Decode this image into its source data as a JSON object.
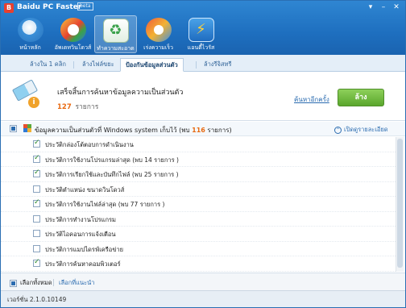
{
  "app": {
    "logo_char": "B",
    "title": "Baidu PC Faster",
    "badge": "beta"
  },
  "window_controls": {
    "feedback": "▾",
    "minimize": "–",
    "close": "✕"
  },
  "nav": [
    {
      "label": "หน้าหลัก",
      "icon": "home-gauge-icon"
    },
    {
      "label": "อัพเดทวินโดวส์",
      "icon": "windows-update-icon"
    },
    {
      "label": "ทำความสะอาด",
      "icon": "recycle-clean-icon"
    },
    {
      "label": "เร่งความเร็ว",
      "icon": "speed-icon"
    },
    {
      "label": "แอนตี้ไวรัส",
      "icon": "antivirus-lightning-icon"
    }
  ],
  "tabs": [
    {
      "label": "ล้างใน 1 คลิก"
    },
    {
      "label": "ล้างไฟล์ขยะ"
    },
    {
      "label": "ป้องกันข้อมูลส่วนตัว",
      "active": true
    },
    {
      "label": "ล้างรีจิสทรี"
    }
  ],
  "summary": {
    "title": "เสร็จสิ้นการค้นหาข้อมูลความเป็นส่วนตัว",
    "count": "127",
    "count_unit": "รายการ",
    "rescan": "ค้นหาอีกครั้ง",
    "clean_button": "ล้าง"
  },
  "group": {
    "title_prefix": "ข้อมูลความเป็นส่วนตัวที่ Windows system เก็บไว้ (พบ",
    "count": "116",
    "title_suffix": "รายการ)",
    "expand": "เปิดดูรายละเอียด"
  },
  "items": [
    {
      "label": "ประวัติกล่องโต้ตอบการดำเนินงาน",
      "checked": true
    },
    {
      "label": "ประวัติการใช้งานโปรแกรมล่าสุด (พบ 14 รายการ )",
      "checked": true
    },
    {
      "label": "ประวัติการเรียกใช้และบันทึกไฟล์ (พบ 25 รายการ )",
      "checked": true
    },
    {
      "label": "ประวัติตำแหน่ง ขนาดวินโดวส์",
      "checked": false
    },
    {
      "label": "ประวัติการใช้งานไฟล์ล่าสุด (พบ 77 รายการ )",
      "checked": true
    },
    {
      "label": "ประวัติการทำงานโปรแกรม",
      "checked": false
    },
    {
      "label": "ประวัติไอคอนการแจ้งเตือน",
      "checked": false
    },
    {
      "label": "ประวัติการแมปไดรฟ์เครือข่าย",
      "checked": false
    },
    {
      "label": "ประวัติการค้นหาคอมพิวเตอร์",
      "checked": true
    }
  ],
  "bottom": {
    "select_all": "เลือกทั้งหมด",
    "recommended": "เลือกที่แนะนำ"
  },
  "status": {
    "version": "เวอร์ชั่น 2.1.0.10149"
  }
}
